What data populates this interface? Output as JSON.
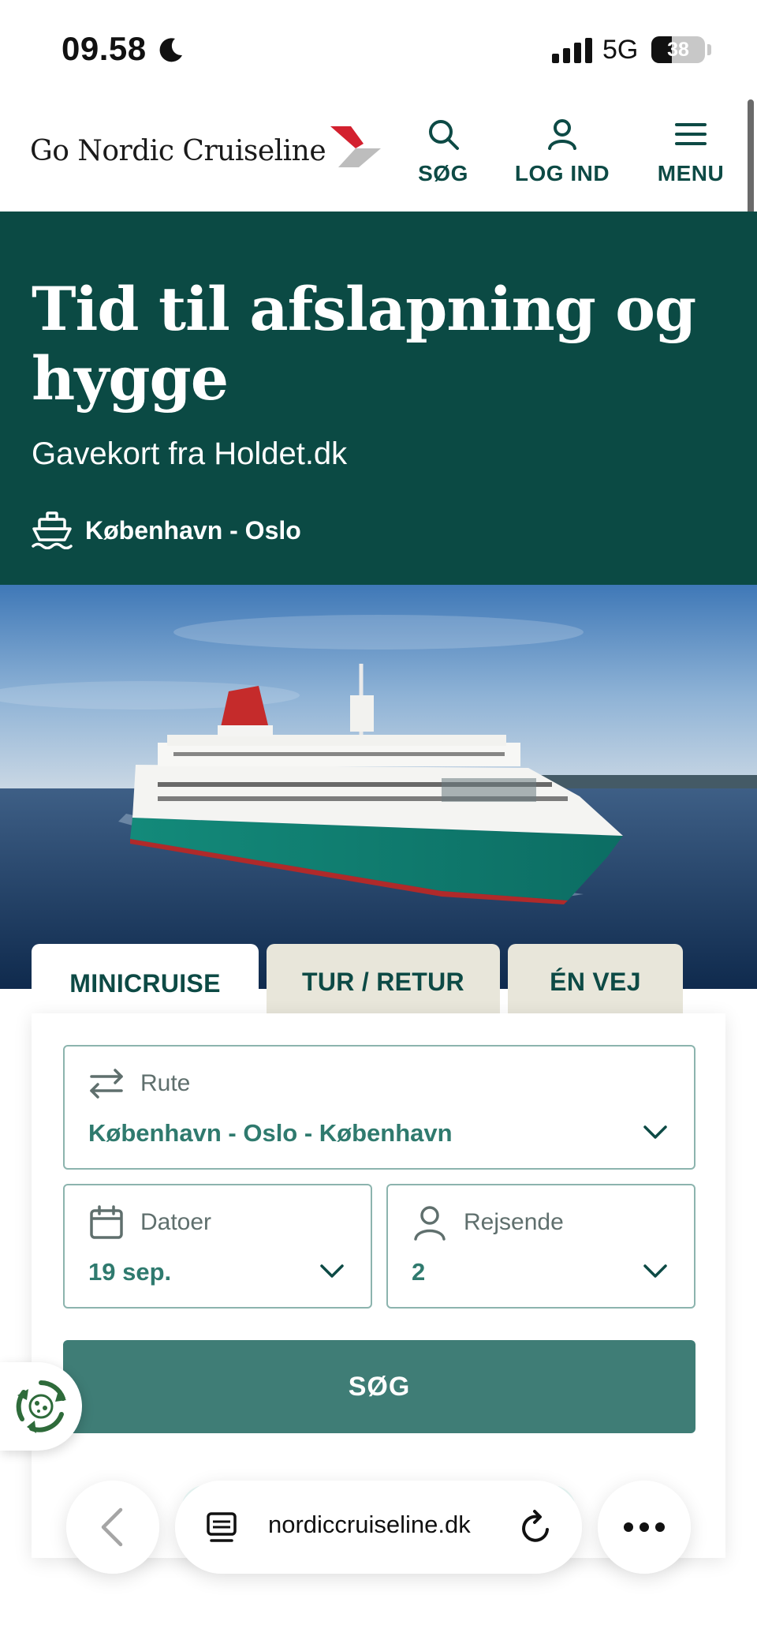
{
  "status_bar": {
    "time": "09.58",
    "network": "5G",
    "battery_level": "38",
    "battery_fraction": 0.38
  },
  "header": {
    "logo_text": "Go Nordic Cruiseline",
    "search_label": "SØG",
    "login_label": "LOG IND",
    "menu_label": "MENU"
  },
  "hero": {
    "title": "Tid til afslapning og hygge",
    "subtitle": "Gavekort fra Holdet.dk",
    "route": "København - Oslo",
    "ship_name": "Go Nordic Cruiseline"
  },
  "booking": {
    "tabs": [
      {
        "label": "MINICRUISE",
        "active": true
      },
      {
        "label": "TUR / RETUR",
        "active": false
      },
      {
        "label": "ÉN VEJ",
        "active": false
      }
    ],
    "route_label": "Rute",
    "route_value": "København - Oslo - København",
    "dates_label": "Datoer",
    "dates_value": "19 sep.",
    "travelers_label": "Rejsende",
    "travelers_value": "2",
    "search_button": "SØG"
  },
  "browser": {
    "url": "nordiccruiseline.dk"
  },
  "colors": {
    "brand_dark": "#0b4a44",
    "accent_red": "#d3202e",
    "button": "#3f7d76",
    "tab_inactive": "#e8e6da"
  }
}
